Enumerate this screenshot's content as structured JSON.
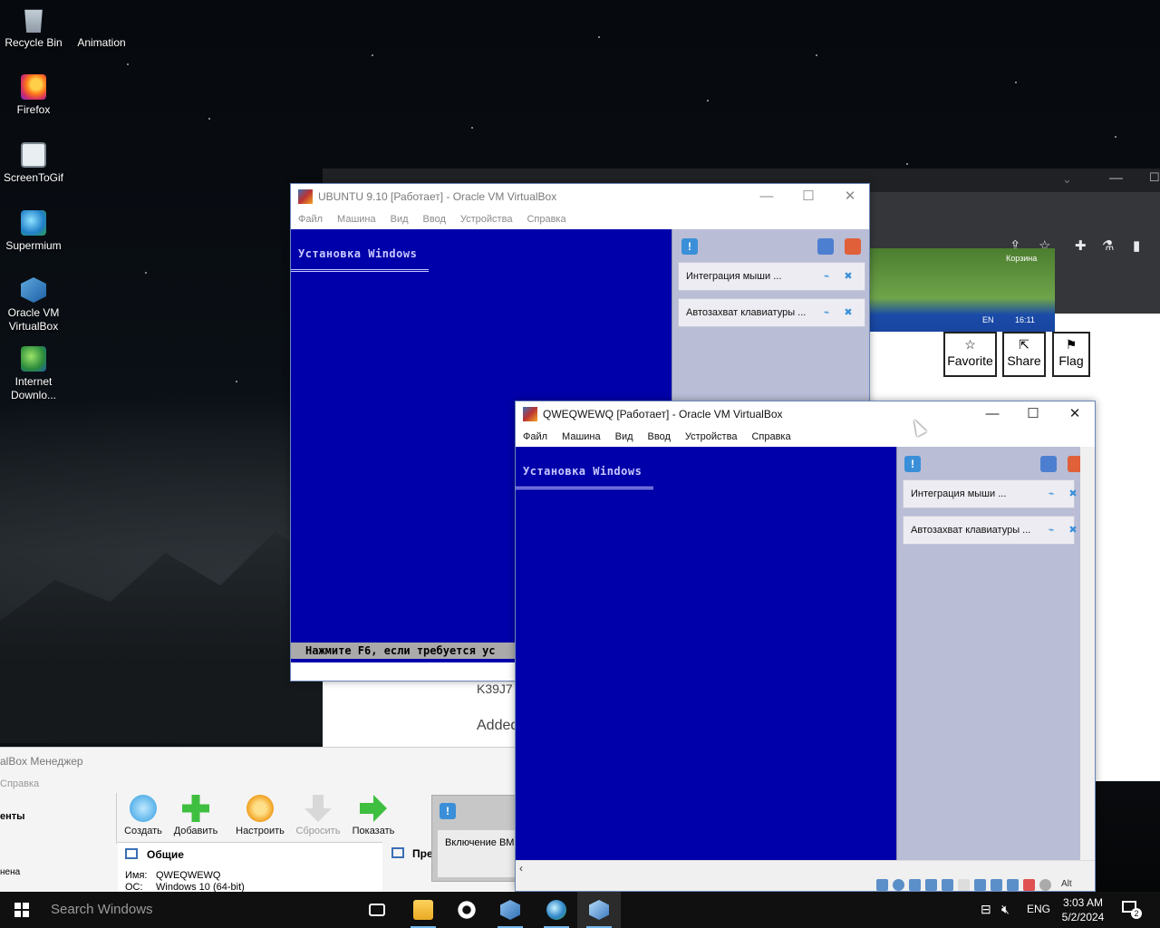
{
  "desktop": {
    "icons": [
      {
        "label": "Recycle Bin",
        "icon": "recycle-bin-icon"
      },
      {
        "label": "Animation",
        "icon": "folder-icon"
      },
      {
        "label": "Firefox",
        "icon": "firefox-icon"
      },
      {
        "label": "ScreenToGif",
        "icon": "screentogif-icon"
      },
      {
        "label": "Supermium",
        "icon": "supermium-icon"
      },
      {
        "label": "Oracle VM VirtualBox",
        "icon": "virtualbox-icon"
      },
      {
        "label": "Internet Downlo...",
        "icon": "idm-icon"
      }
    ]
  },
  "browser": {
    "thumb_caption": "Корзина",
    "thumb_lang": "EN",
    "thumb_time": "16:11",
    "buttons": {
      "favorite": "Favorite",
      "share": "Share",
      "flag": "Flag"
    },
    "text_fragment_1": "K39J7",
    "text_fragment_2": "Added"
  },
  "vbox_manager": {
    "title": "alBox Менеджер",
    "menu_fragment": "Справка",
    "left_label": "енты",
    "left_label_2": "нена",
    "tools": [
      "Создать",
      "Добавить",
      "Настроить",
      "Сбросить",
      "Показать"
    ],
    "section_general": "Общие",
    "section_preview": "Пре",
    "name_label": "Имя:",
    "name_value": "QWEQWEWQ",
    "os_label": "ОС:",
    "os_value": "Windows 10 (64-bit)",
    "notify_text": "Включение ВМ"
  },
  "vm_ubuntu": {
    "title": "UBUNTU 9.10 [Работает] - Oracle VM VirtualBox",
    "menu": [
      "Файл",
      "Машина",
      "Вид",
      "Ввод",
      "Устройства",
      "Справка"
    ],
    "setup_title": "Установка Windows",
    "status_line": "Нажмите F6, если требуется ус",
    "notify_cards": [
      "Интеграция мыши ...",
      "Автозахват клавиатуры ..."
    ]
  },
  "vm_qwe": {
    "title": "QWEQWEWQ [Работает] - Oracle VM VirtualBox",
    "menu": [
      "Файл",
      "Машина",
      "Вид",
      "Ввод",
      "Устройства",
      "Справка"
    ],
    "setup_title": "Установка Windows",
    "notify_cards": [
      "Интеграция мыши ...",
      "Автозахват клавиатуры ..."
    ],
    "host_key": "Alt"
  },
  "taskbar": {
    "search_placeholder": "Search Windows",
    "language": "ENG",
    "time": "3:03 AM",
    "date": "5/2/2024",
    "notification_count": "2"
  },
  "colors": {
    "vm_screen": "#0000aa",
    "taskbar": "#101010",
    "accent": "#76b9ed"
  }
}
